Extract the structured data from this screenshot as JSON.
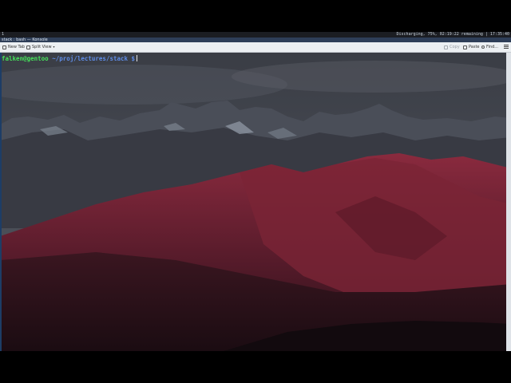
{
  "statusbar": {
    "workspace": "1",
    "system_info": "Discharging, 75%, 02:19:22 remaining | 17:35:40"
  },
  "window": {
    "title": "stack : bash — Konsole"
  },
  "toolbar": {
    "new_tab_label": "New Tab",
    "split_view_label": "Split View",
    "copy_label": "Copy",
    "paste_label": "Paste",
    "find_label": "Find..."
  },
  "terminal": {
    "prompt_user_host": "falken@gentoo",
    "prompt_path": " ~/proj/lectures/stack $",
    "background": "mountain-landscape-wallpaper",
    "colors": {
      "user_host": "#46e25b",
      "path": "#5f8de8"
    }
  }
}
